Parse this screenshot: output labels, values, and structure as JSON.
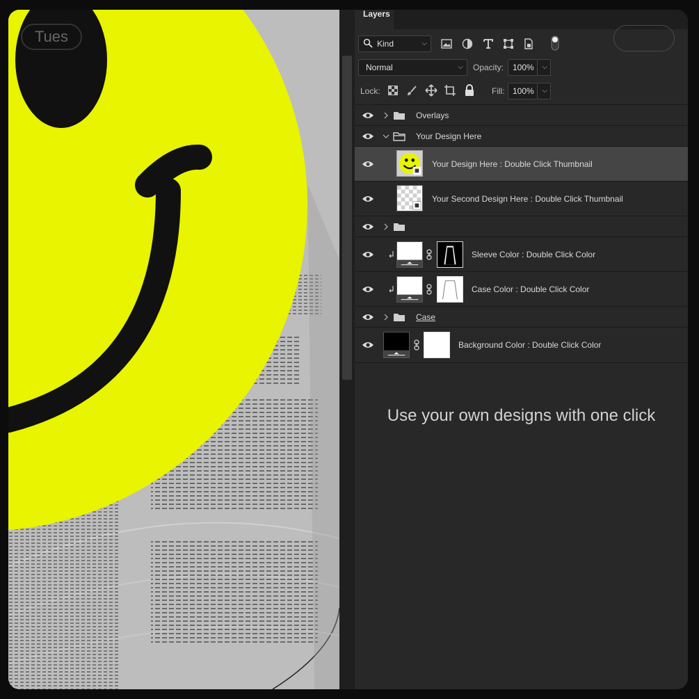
{
  "canvas": {
    "day_label": "Tues",
    "accent_yellow": "#e8f400"
  },
  "panel": {
    "tab_label": "Layers",
    "filter": {
      "kind_label": "Kind"
    },
    "blend_mode": "Normal",
    "opacity_label": "Opacity:",
    "opacity_value": "100%",
    "lock_label": "Lock:",
    "fill_label": "Fill:",
    "fill_value": "100%",
    "layers": [
      {
        "name": "Overlays",
        "kind": "group",
        "expanded": false,
        "visible": true
      },
      {
        "name": "Your Design Here",
        "kind": "group",
        "expanded": true,
        "visible": true
      },
      {
        "name": "Your Design Here : Double Click Thumbnail",
        "kind": "smart-object",
        "selected": true,
        "visible": true
      },
      {
        "name": "Your Second Design Here : Double Click Thumbnail",
        "kind": "smart-object",
        "visible": true
      },
      {
        "name": "",
        "kind": "group",
        "expanded": false,
        "visible": true
      },
      {
        "name": "Sleeve Color : Double Click Color",
        "kind": "fill-layer",
        "clipped": true,
        "visible": true
      },
      {
        "name": "Case Color : Double Click Color",
        "kind": "fill-layer",
        "clipped": true,
        "visible": true
      },
      {
        "name": "Case",
        "kind": "group",
        "expanded": false,
        "visible": true
      },
      {
        "name": "Background Color : Double Click Color",
        "kind": "fill-layer",
        "visible": true
      }
    ]
  },
  "tagline": "Use your own designs with one click",
  "icons": [
    "search-icon",
    "image-filter-icon",
    "adjustment-filter-icon",
    "type-filter-icon",
    "shape-filter-icon",
    "smart-filter-icon",
    "filter-toggle-icon",
    "eye-icon",
    "folder-icon",
    "chevron-icon",
    "link-icon",
    "clip-arrow-icon",
    "lock-pixels-icon",
    "lock-brush-icon",
    "lock-move-icon",
    "lock-artboard-icon",
    "lock-all-icon"
  ]
}
